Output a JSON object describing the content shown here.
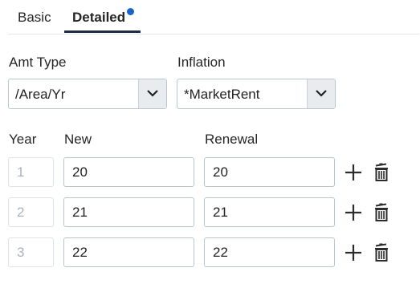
{
  "tabs": [
    {
      "label": "Basic"
    },
    {
      "label": "Detailed"
    }
  ],
  "amt_type": {
    "label": "Amt Type",
    "value": "/Area/Yr"
  },
  "inflation": {
    "label": "Inflation",
    "value": "*MarketRent"
  },
  "columns": {
    "year": "Year",
    "new": "New",
    "renewal": "Renewal"
  },
  "rows": [
    {
      "year": "1",
      "new": "20",
      "renewal": "20"
    },
    {
      "year": "2",
      "new": "21",
      "renewal": "21"
    },
    {
      "year": "3",
      "new": "22",
      "renewal": "22"
    }
  ],
  "colors": {
    "accent_dot": "#1a63c8",
    "tab_underline": "#1b2f4b",
    "border": "#b9c6cf"
  },
  "icons": {
    "dropdown": "chevron-down-icon",
    "add": "plus-icon",
    "delete": "trash-icon"
  }
}
